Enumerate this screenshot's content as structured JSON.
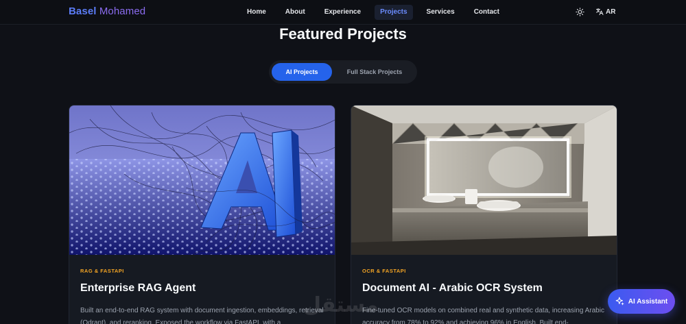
{
  "brand": {
    "first": "Basel",
    "last": "Mohamed"
  },
  "nav": {
    "items": [
      {
        "label": "Home",
        "active": false
      },
      {
        "label": "About",
        "active": false
      },
      {
        "label": "Experience",
        "active": false
      },
      {
        "label": "Projects",
        "active": true
      },
      {
        "label": "Services",
        "active": false
      },
      {
        "label": "Contact",
        "active": false
      }
    ],
    "theme_icon": "sun-icon",
    "language": {
      "icon": "translate-icon",
      "label": "AR"
    }
  },
  "section": {
    "title": "Featured Projects"
  },
  "tabs": [
    {
      "label": "AI Projects",
      "active": true
    },
    {
      "label": "Full Stack Projects",
      "active": false
    }
  ],
  "projects": [
    {
      "tag": "RAG & FASTAPI",
      "title": "Enterprise RAG Agent",
      "description": "Built an end-to-end RAG system with document ingestion, embeddings, retrieval (Qdrant), and reranking. Exposed the workflow via FastAPI, with a",
      "image_subject": "3D letters AI on hexagon floor"
    },
    {
      "tag": "OCR & FASTAPI",
      "title": "Document AI - Arabic OCR System",
      "description": "Fine-tuned OCR models on combined real and synthetic data, increasing Arabic accuracy from 78% to 92% and achieving 96% in English. Built end-",
      "image_subject": "bathroom with illuminated mirror and sinks"
    }
  ],
  "watermark": "مستقل",
  "assistant": {
    "label": "AI Assistant",
    "icon": "sparkle-icon"
  },
  "colors": {
    "background": "#0f1117",
    "accent": "#2563eb",
    "tag": "#f5a524",
    "brand_first": "#5b7cf6",
    "brand_last": "#8b6cf0"
  }
}
